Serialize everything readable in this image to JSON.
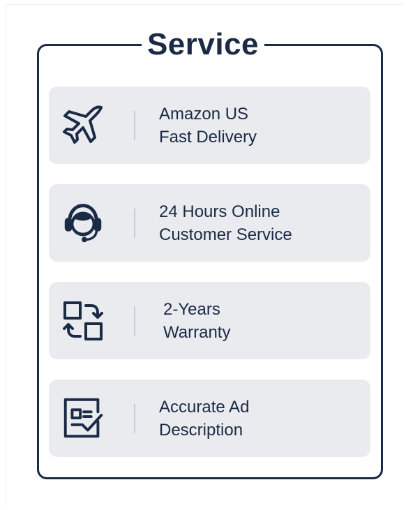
{
  "title": "Service",
  "colors": {
    "navy": "#1b2a45",
    "card": "#e9ebee"
  },
  "services": [
    {
      "icon": "airplane-icon",
      "line1": "Amazon US",
      "line2": "Fast Delivery"
    },
    {
      "icon": "headset-icon",
      "line1": "24 Hours Online",
      "line2": "Customer Service"
    },
    {
      "icon": "exchange-icon",
      "line1": "2-Years",
      "line2": "Warranty"
    },
    {
      "icon": "checklist-icon",
      "line1": "Accurate Ad",
      "line2": "Description"
    }
  ]
}
